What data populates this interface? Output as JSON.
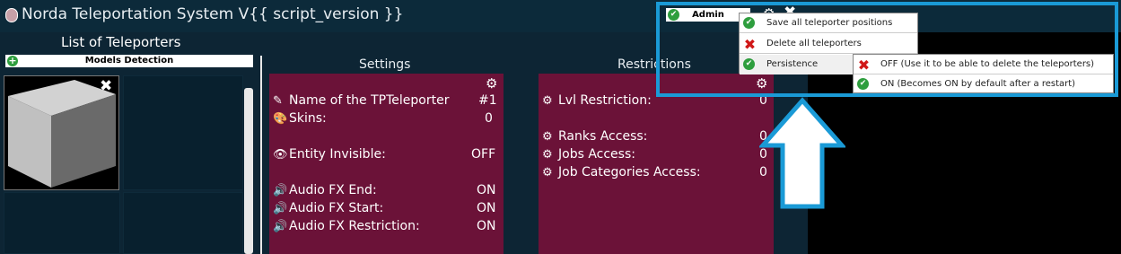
{
  "title": "Norda Teleportation System V{{ script_version }}",
  "sidebar": {
    "title": "List of Teleporters",
    "models_button": "Models Detection"
  },
  "settings": {
    "title": "Settings",
    "rows": [
      {
        "label": "Name of the TPTeleporter",
        "value": "#1",
        "icon": "pencil-icon"
      },
      {
        "label": "Skins:",
        "value": "0",
        "icon": "palette-icon"
      },
      {
        "label": "Entity Invisible:",
        "value": "OFF",
        "icon": "eye-icon"
      },
      {
        "label": "Audio FX End:",
        "value": "ON",
        "icon": "speaker-icon"
      },
      {
        "label": "Audio FX Start:",
        "value": "ON",
        "icon": "speaker-icon"
      },
      {
        "label": "Audio FX Restriction:",
        "value": "ON",
        "icon": "speaker-icon"
      }
    ]
  },
  "restrictions": {
    "title": "Restrictions",
    "rows": [
      {
        "label": "Lvl Restriction:",
        "value": "0",
        "icon": "gear-icon"
      },
      {
        "label": "Ranks Access:",
        "value": "0",
        "icon": "gear-icon"
      },
      {
        "label": "Jobs Access:",
        "value": "0",
        "icon": "gear-icon"
      },
      {
        "label": "Job Categories Access:",
        "value": "0",
        "icon": "gear-icon"
      }
    ]
  },
  "admin": {
    "button": "Admin",
    "menu": [
      {
        "label": "Save all teleporter positions",
        "icon": "check-icon"
      },
      {
        "label": "Delete all teleporters",
        "icon": "x-icon"
      },
      {
        "label": "Persistence",
        "icon": "check-icon"
      }
    ],
    "submenu": [
      {
        "label": "OFF (Use it to be able to delete the teleporters)",
        "icon": "x-icon"
      },
      {
        "label": "ON (Becomes ON by default after a restart)",
        "icon": "check-icon"
      }
    ]
  },
  "colors": {
    "panel": "#6b1238",
    "background": "#0d2534",
    "highlight": "#1a9ad6"
  }
}
